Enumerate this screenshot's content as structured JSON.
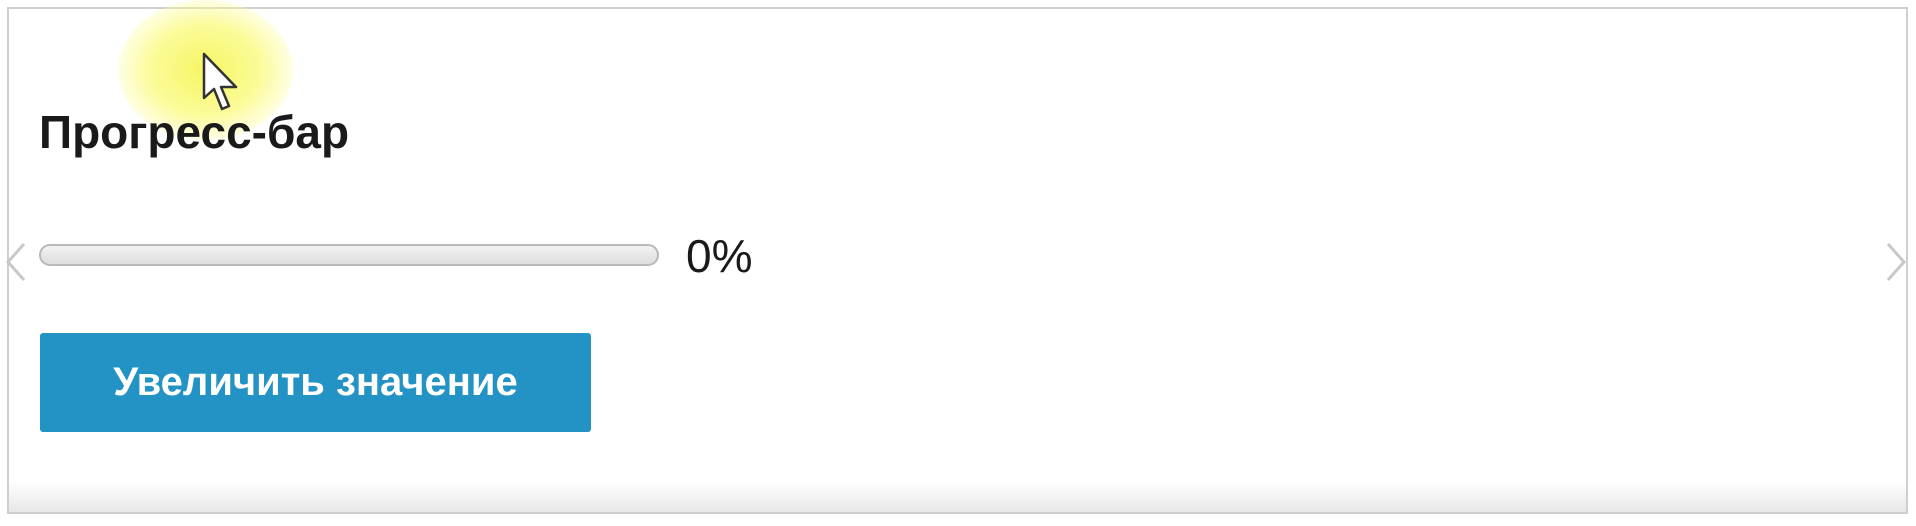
{
  "widget": {
    "title": "Прогресс-бар",
    "progress": {
      "value_percent": 0,
      "label": "0%"
    },
    "increase_button_label": "Увеличить значение"
  },
  "icons": {
    "prev": "chevron-left-icon",
    "next": "chevron-right-icon",
    "pointer": "mouse-pointer-icon"
  },
  "colors": {
    "button": "#2393c5",
    "highlight": "#f5f55a"
  }
}
